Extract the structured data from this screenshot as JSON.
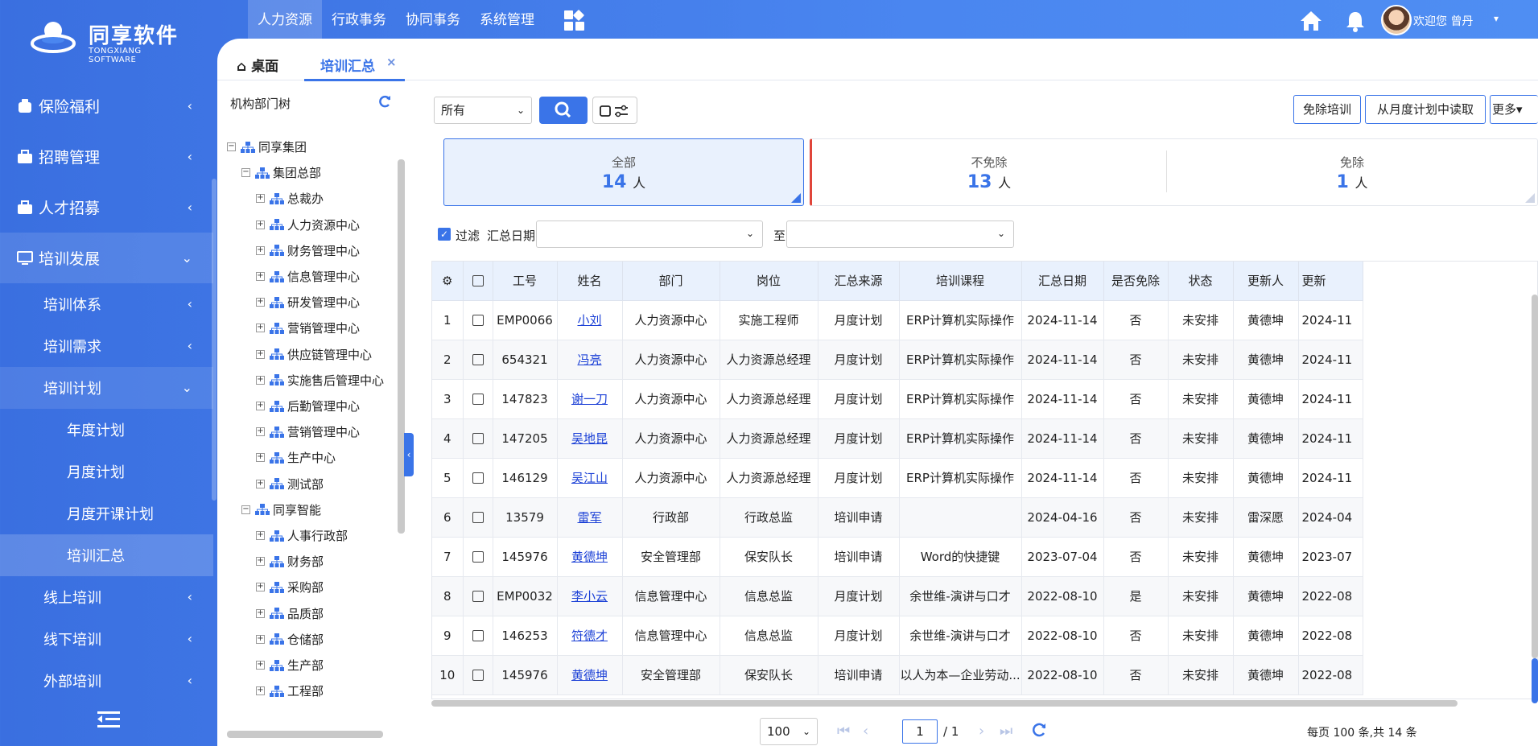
{
  "brand": {
    "name": "同享软件",
    "sub": "TONGXIANG SOFTWARE"
  },
  "topnav": [
    "人力资源",
    "行政事务",
    "协同事务",
    "系统管理"
  ],
  "user": {
    "welcome": "欢迎您  曾丹",
    "caret": "▾"
  },
  "sidebar": {
    "l1": [
      "保险福利",
      "招聘管理",
      "人才招募",
      "培训发展"
    ],
    "l2": [
      "培训体系",
      "培训需求",
      "培训计划",
      "线上培训",
      "线下培训",
      "外部培训"
    ],
    "l3": [
      "年度计划",
      "月度计划",
      "月度开课计划",
      "培训汇总"
    ]
  },
  "tabs": {
    "home": "桌面",
    "current": "培训汇总",
    "close": "×"
  },
  "tree": {
    "title": "机构部门树",
    "nodes": [
      "同享集团",
      "集团总部",
      "总裁办",
      "人力资源中心",
      "财务管理中心",
      "信息管理中心",
      "研发管理中心",
      "营销管理中心",
      "供应链管理中心",
      "实施售后管理中心",
      "后勤管理中心",
      "营销管理中心",
      "生产中心",
      "测试部",
      "同享智能",
      "人事行政部",
      "财务部",
      "采购部",
      "品质部",
      "仓储部",
      "生产部",
      "工程部"
    ],
    "search_btn": "查找"
  },
  "toolbar": {
    "filter_value": "所有",
    "btn_exempt": "免除培训",
    "btn_monthly": "从月度计划中读取",
    "btn_more": "更多"
  },
  "stats": {
    "all_label": "全部",
    "all_value": "14",
    "unit": "人",
    "notexempt_label": "不免除",
    "notexempt_value": "13",
    "exempt_label": "免除",
    "exempt_value": "1"
  },
  "filter": {
    "label": "过滤",
    "date_label": "汇总日期:",
    "to_label": "至"
  },
  "table": {
    "columns": [
      "工号",
      "姓名",
      "部门",
      "岗位",
      "汇总来源",
      "培训课程",
      "汇总日期",
      "是否免除",
      "状态",
      "更新人",
      "更新"
    ],
    "rows": [
      [
        "1",
        "EMP0066",
        "小刘",
        "人力资源中心",
        "实施工程师",
        "月度计划",
        "ERP计算机实际操作",
        "2024-11-14",
        "否",
        "未安排",
        "黄德坤",
        "2024-11"
      ],
      [
        "2",
        "654321",
        "冯亮",
        "人力资源中心",
        "人力资源总经理",
        "月度计划",
        "ERP计算机实际操作",
        "2024-11-14",
        "否",
        "未安排",
        "黄德坤",
        "2024-11"
      ],
      [
        "3",
        "147823",
        "谢一刀",
        "人力资源中心",
        "人力资源总经理",
        "月度计划",
        "ERP计算机实际操作",
        "2024-11-14",
        "否",
        "未安排",
        "黄德坤",
        "2024-11"
      ],
      [
        "4",
        "147205",
        "吴地昆",
        "人力资源中心",
        "人力资源总经理",
        "月度计划",
        "ERP计算机实际操作",
        "2024-11-14",
        "否",
        "未安排",
        "黄德坤",
        "2024-11"
      ],
      [
        "5",
        "146129",
        "吴江山",
        "人力资源中心",
        "人力资源总经理",
        "月度计划",
        "ERP计算机实际操作",
        "2024-11-14",
        "否",
        "未安排",
        "黄德坤",
        "2024-11"
      ],
      [
        "6",
        "13579",
        "雷军",
        "行政部",
        "行政总监",
        "培训申请",
        "",
        "2024-04-16",
        "否",
        "未安排",
        "雷深愿",
        "2024-04"
      ],
      [
        "7",
        "145976",
        "黄德坤",
        "安全管理部",
        "保安队长",
        "培训申请",
        "Word的快捷键",
        "2023-07-04",
        "否",
        "未安排",
        "黄德坤",
        "2023-07"
      ],
      [
        "8",
        "EMP0032",
        "李小云",
        "信息管理中心",
        "信息总监",
        "月度计划",
        "余世维-演讲与口才",
        "2022-08-10",
        "是",
        "未安排",
        "黄德坤",
        "2022-08"
      ],
      [
        "9",
        "146253",
        "符德才",
        "信息管理中心",
        "信息总监",
        "月度计划",
        "余世维-演讲与口才",
        "2022-08-10",
        "否",
        "未安排",
        "黄德坤",
        "2022-08"
      ],
      [
        "10",
        "145976",
        "黄德坤",
        "安全管理部",
        "保安队长",
        "培训申请",
        "以人为本—企业劳动...",
        "2022-08-10",
        "否",
        "未安排",
        "黄德坤",
        "2022-08"
      ]
    ]
  },
  "pager": {
    "page_size": "100",
    "page": "1",
    "total": "/ 1",
    "info": "每页 100 条,共 14 条"
  },
  "colors": {
    "accent": "#3a74e8",
    "sidebar": "#4a86f0",
    "header_bg": "#e9f1fd",
    "danger": "#e0453a"
  }
}
